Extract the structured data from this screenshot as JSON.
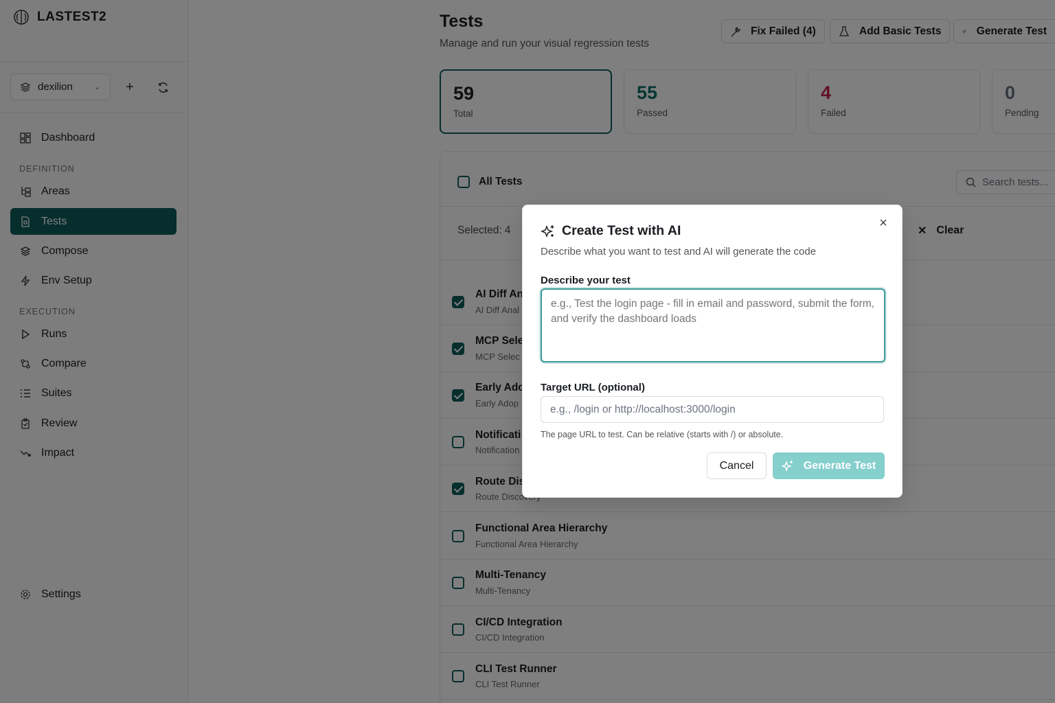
{
  "app": {
    "brand": "LASTEST2"
  },
  "sidebar": {
    "project": "dexilion",
    "nav_top": [
      {
        "label": "Dashboard",
        "icon": "dashboard-icon"
      }
    ],
    "section_definition": "DEFINITION",
    "definition_items": [
      {
        "label": "Areas",
        "icon": "areas-icon"
      },
      {
        "label": "Tests",
        "icon": "file-icon",
        "active": true
      },
      {
        "label": "Compose",
        "icon": "layers-icon"
      },
      {
        "label": "Env Setup",
        "icon": "zap-icon"
      }
    ],
    "section_execution": "EXECUTION",
    "execution_items": [
      {
        "label": "Runs",
        "icon": "play-icon"
      },
      {
        "label": "Compare",
        "icon": "git-compare-icon"
      },
      {
        "label": "Suites",
        "icon": "list-icon"
      },
      {
        "label": "Review",
        "icon": "clipboard-check-icon"
      },
      {
        "label": "Impact",
        "icon": "trend-down-icon"
      }
    ],
    "settings": "Settings"
  },
  "header": {
    "title": "Tests",
    "subtitle": "Manage and run your visual regression tests",
    "fix_failed": "Fix Failed (4)",
    "add_basic": "Add Basic Tests",
    "generate": "Generate Test"
  },
  "stats": [
    {
      "value": "59",
      "label": "Total",
      "color": "#1a1d21"
    },
    {
      "value": "55",
      "label": "Passed",
      "color": "#0d6e66"
    },
    {
      "value": "4",
      "label": "Failed",
      "color": "#c81e4a"
    },
    {
      "value": "0",
      "label": "Pending",
      "color": "#6b7280"
    }
  ],
  "list": {
    "all_tests": "All Tests",
    "search_placeholder": "Search tests...",
    "selected": "Selected: 4",
    "clear": "Clear",
    "rows": [
      {
        "title": "AI Diff An",
        "sub": "AI Diff Anal",
        "checked": true
      },
      {
        "title": "MCP Sele",
        "sub": "MCP Selec",
        "checked": true
      },
      {
        "title": "Early Adc",
        "sub": "Early Adop",
        "checked": true
      },
      {
        "title": "Notificati",
        "sub": "Notification",
        "checked": false
      },
      {
        "title": "Route Dis",
        "sub": "Route Discovery",
        "checked": true
      },
      {
        "title": "Functional Area Hierarchy",
        "sub": "Functional Area Hierarchy",
        "checked": false
      },
      {
        "title": "Multi-Tenancy",
        "sub": "Multi-Tenancy",
        "checked": false
      },
      {
        "title": "CI/CD Integration",
        "sub": "CI/CD Integration",
        "checked": false
      },
      {
        "title": "CLI Test Runner",
        "sub": "CLI Test Runner",
        "checked": false
      }
    ]
  },
  "modal": {
    "title": "Create Test with AI",
    "description": "Describe what you want to test and AI will generate the code",
    "describe_label": "Describe your test",
    "describe_placeholder": "e.g., Test the login page - fill in email and password, submit the form, and verify the dashboard loads",
    "url_label": "Target URL (optional)",
    "url_placeholder": "e.g., /login or http://localhost:3000/login",
    "url_help": "The page URL to test. Can be relative (starts with /) or absolute.",
    "cancel": "Cancel",
    "generate": "Generate Test"
  },
  "colors": {
    "accent": "#0d5c5a",
    "accent_light": "#85cfcd",
    "failed": "#c81e4a"
  }
}
